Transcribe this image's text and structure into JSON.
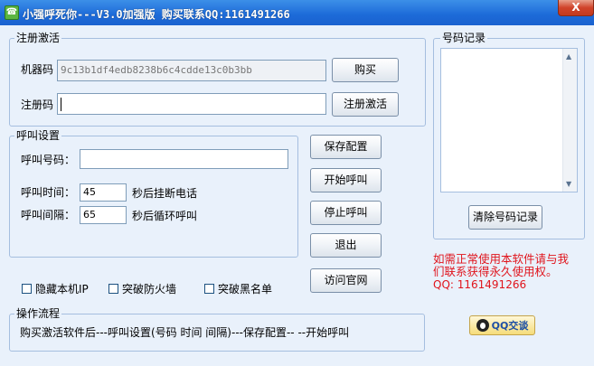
{
  "window": {
    "title": "小强呼死你---V3.0加强版 购买联系QQ:1161491266",
    "close_label": "X"
  },
  "registration": {
    "legend": "注册激活",
    "machine_code_label": "机器码",
    "machine_code_value": "9c13b1df4edb8238b6c4cdde13c0b3bb",
    "buy_label": "购买",
    "reg_code_label": "注册码",
    "reg_code_value": "",
    "activate_label": "注册激活"
  },
  "call_settings": {
    "legend": "呼叫设置",
    "number_label": "呼叫号码：",
    "number_value": "",
    "time_label": "呼叫时间：",
    "time_value": "45",
    "time_suffix": "秒后挂断电话",
    "interval_label": "呼叫间隔：",
    "interval_value": "65",
    "interval_suffix": "秒后循环呼叫"
  },
  "actions": {
    "save": "保存配置",
    "start": "开始呼叫",
    "stop": "停止呼叫",
    "exit": "退出",
    "website": "访问官网"
  },
  "options": {
    "hide_ip": "隐藏本机IP",
    "firewall": "突破防火墙",
    "blacklist": "突破黑名单"
  },
  "process": {
    "legend": "操作流程",
    "text": "购买激活软件后---呼叫设置(号码  时间 间隔)---保存配置-- --开始呼叫"
  },
  "records": {
    "legend": "号码记录",
    "clear_label": "清除号码记录"
  },
  "promo": {
    "line1": "如需正常使用本软件请与我",
    "line2": "们联系获得永久使用权。",
    "line3": "QQ: 1161491266"
  },
  "qq_button": {
    "label": "QQ交谈"
  },
  "colors": {
    "promo": "#e0141c",
    "titlebar": "#1c6ad8"
  }
}
